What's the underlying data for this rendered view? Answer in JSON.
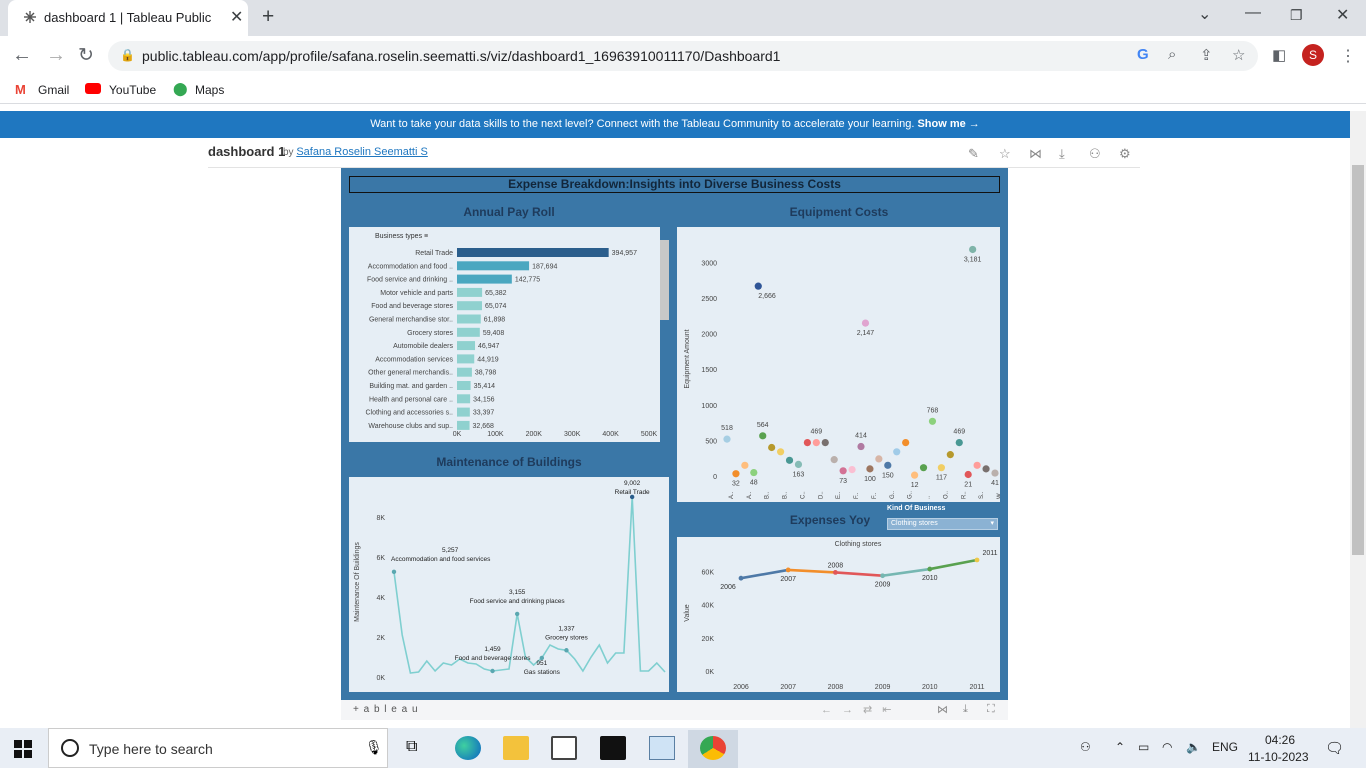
{
  "browser": {
    "tab_title": "dashboard 1 | Tableau Public",
    "url": "public.tableau.com/app/profile/safana.roselin.seematti.s/viz/dashboard1_16963910011170/Dashboard1",
    "profile_initial": "S",
    "bookmarks": [
      "Gmail",
      "YouTube",
      "Maps"
    ]
  },
  "banner": {
    "text": "Want to take your data skills to the next level? Connect with the Tableau Community to accelerate your learning.",
    "link": "Show me →"
  },
  "header": {
    "title": "dashboard 1",
    "by": "by",
    "author": "Safana Roselin Seematti S"
  },
  "dashboard": {
    "title": "Expense Breakdown:Insights into Diverse Business Costs",
    "payroll_title": "Annual Pay Roll",
    "equipment_title": "Equipment Costs",
    "maintenance_title": "Maintenance of Buildings",
    "yoy_title": "Expenses Yoy",
    "filter_label": "Kind Of Business",
    "filter_value": "Clothing stores",
    "footer_brand": "+ a b l e a u"
  },
  "chart_data": [
    {
      "type": "bar",
      "title": "Annual Pay Roll",
      "legend_header": "Business types",
      "categories": [
        "Retail Trade",
        "Accommodation and food ..",
        "Food service and drinking ..",
        "Motor vehicle and parts",
        "Food and beverage stores",
        "General merchandise stor..",
        "Grocery stores",
        "Automobile dealers",
        "Accommodation services",
        "Other general merchandis..",
        "Building mat. and garden ..",
        "Health and personal care ..",
        "Clothing and accessories s..",
        "Warehouse clubs and sup.."
      ],
      "values": [
        394957,
        187694,
        142775,
        65382,
        65074,
        61898,
        59408,
        46947,
        44919,
        38798,
        35414,
        34156,
        33397,
        32668
      ],
      "labels": [
        "394,957",
        "187,694",
        "142,775",
        "65,382",
        "65,074",
        "61,898",
        "59,408",
        "46,947",
        "44,919",
        "38,798",
        "35,414",
        "34,156",
        "33,397",
        "32,668"
      ],
      "xticks": [
        "0K",
        "100K",
        "200K",
        "300K",
        "400K",
        "500K"
      ],
      "xlim": [
        0,
        500000
      ]
    },
    {
      "type": "scatter",
      "title": "Equipment Costs",
      "ylabel": "Equipment Amount",
      "yticks": [
        "0",
        "500",
        "1000",
        "1500",
        "2000",
        "2500",
        "3000"
      ],
      "ylim": [
        0,
        3300
      ],
      "x_tick_letters": [
        "A..",
        "A..",
        "B..",
        "B..",
        "C..",
        "D..",
        "E..",
        "F..",
        "F..",
        "G..",
        "G..",
        "..",
        "O..",
        "R..",
        "S..",
        "W.."
      ],
      "points": [
        {
          "i": 1,
          "v": 518,
          "label": "518",
          "color": "#a6cee3"
        },
        {
          "i": 2,
          "v": 32,
          "label": "32",
          "color": "#f28e2b"
        },
        {
          "i": 3,
          "v": 150,
          "label": "",
          "color": "#ffbe7d"
        },
        {
          "i": 4,
          "v": 48,
          "label": "48",
          "color": "#8cd17d"
        },
        {
          "i": 5,
          "v": 564,
          "label": "564",
          "color": "#59a14f"
        },
        {
          "i": 6,
          "v": 400,
          "label": "",
          "color": "#b6992d"
        },
        {
          "i": 7,
          "v": 340,
          "label": "",
          "color": "#f1ce63"
        },
        {
          "i": 8,
          "v": 220,
          "label": "",
          "color": "#499894"
        },
        {
          "i": 9,
          "v": 163,
          "label": "163",
          "color": "#86bcb6"
        },
        {
          "i": 10,
          "v": 469,
          "label": "",
          "color": "#e15759"
        },
        {
          "i": 11,
          "v": 469,
          "label": "469",
          "color": "#ff9d9a"
        },
        {
          "i": 12,
          "v": 469,
          "label": "",
          "color": "#79706e"
        },
        {
          "i": 13,
          "v": 230,
          "label": "",
          "color": "#bab0ac"
        },
        {
          "i": 14,
          "v": 73,
          "label": "73",
          "color": "#d37295"
        },
        {
          "i": 15,
          "v": 90,
          "label": "",
          "color": "#fabfd2"
        },
        {
          "i": 16,
          "v": 414,
          "label": "414",
          "color": "#b07aa1"
        },
        {
          "i": 17,
          "v": 100,
          "label": "100",
          "color": "#9d7660"
        },
        {
          "i": 18,
          "v": 240,
          "label": "",
          "color": "#d7b5a6"
        },
        {
          "i": 19,
          "v": 150,
          "label": "150",
          "color": "#4e79a7"
        },
        {
          "i": 20,
          "v": 340,
          "label": "",
          "color": "#a0cbe8"
        },
        {
          "i": 21,
          "v": 469,
          "label": "",
          "color": "#f28e2b"
        },
        {
          "i": 22,
          "v": 12,
          "label": "12",
          "color": "#ffbe7d"
        },
        {
          "i": 23,
          "v": 117,
          "label": "",
          "color": "#59a14f"
        },
        {
          "i": 24,
          "v": 768,
          "label": "768",
          "color": "#8cd17d"
        },
        {
          "i": 25,
          "v": 117,
          "label": "117",
          "color": "#f1ce63"
        },
        {
          "i": 26,
          "v": 300,
          "label": "",
          "color": "#b6992d"
        },
        {
          "i": 27,
          "v": 469,
          "label": "469",
          "color": "#499894"
        },
        {
          "i": 28,
          "v": 21,
          "label": "21",
          "color": "#e15759"
        },
        {
          "i": 29,
          "v": 150,
          "label": "",
          "color": "#ff9d9a"
        },
        {
          "i": 30,
          "v": 100,
          "label": "",
          "color": "#79706e"
        },
        {
          "i": 31,
          "v": 41,
          "label": "41",
          "color": "#bab0ac"
        },
        {
          "i": 4.5,
          "v": 2666,
          "label": "2,666",
          "color": "#2f5597",
          "pos": "left"
        },
        {
          "i": 16.5,
          "v": 2147,
          "label": "2,147",
          "color": "#e0a4d0",
          "pos": "mid"
        },
        {
          "i": 28.5,
          "v": 3181,
          "label": "3,181",
          "color": "#7fb4a9",
          "pos": "right"
        }
      ]
    },
    {
      "type": "line",
      "title": "Maintenance of Buildings",
      "ylabel": "Maintenance Of Buildings",
      "yticks": [
        "0K",
        "2K",
        "4K",
        "6K",
        "8K"
      ],
      "ylim": [
        0,
        9500
      ],
      "values": [
        5257,
        2100,
        200,
        250,
        800,
        300,
        700,
        600,
        900,
        700,
        650,
        400,
        300,
        350,
        400,
        3155,
        1000,
        600,
        951,
        1600,
        1400,
        1337,
        900,
        300,
        1000,
        1600,
        700,
        1200,
        1200,
        9002,
        300,
        300,
        700,
        250
      ],
      "annotations": [
        {
          "idx": 0,
          "value": "5,257",
          "name": "Accommodation and food services"
        },
        {
          "idx": 15,
          "value": "3,155",
          "name": "Food service and drinking places"
        },
        {
          "idx": 12,
          "value": "1,459",
          "name": "Food and beverage stores"
        },
        {
          "idx": 21,
          "value": "1,337",
          "name": "Grocery stores"
        },
        {
          "idx": 18,
          "value": "951",
          "name": "Gas stations"
        },
        {
          "idx": 29,
          "value": "9,002",
          "name": "Retail Trade"
        }
      ]
    },
    {
      "type": "line",
      "title": "Expenses Yoy",
      "subtitle": "Clothing stores",
      "ylabel": "Value",
      "x": [
        "2006",
        "2007",
        "2008",
        "2009",
        "2010",
        "2011"
      ],
      "values": [
        56000,
        61000,
        59500,
        57500,
        61500,
        67000
      ],
      "yticks": [
        "0K",
        "20K",
        "40K",
        "60K"
      ],
      "ylim": [
        0,
        70000
      ],
      "colors": [
        "#4e79a7",
        "#f28e2b",
        "#e15759",
        "#76b7b2",
        "#59a14f",
        "#edc948"
      ]
    }
  ],
  "taskbar": {
    "search_placeholder": "Type here to search",
    "language": "ENG",
    "time": "04:26",
    "date": "11-10-2023"
  }
}
